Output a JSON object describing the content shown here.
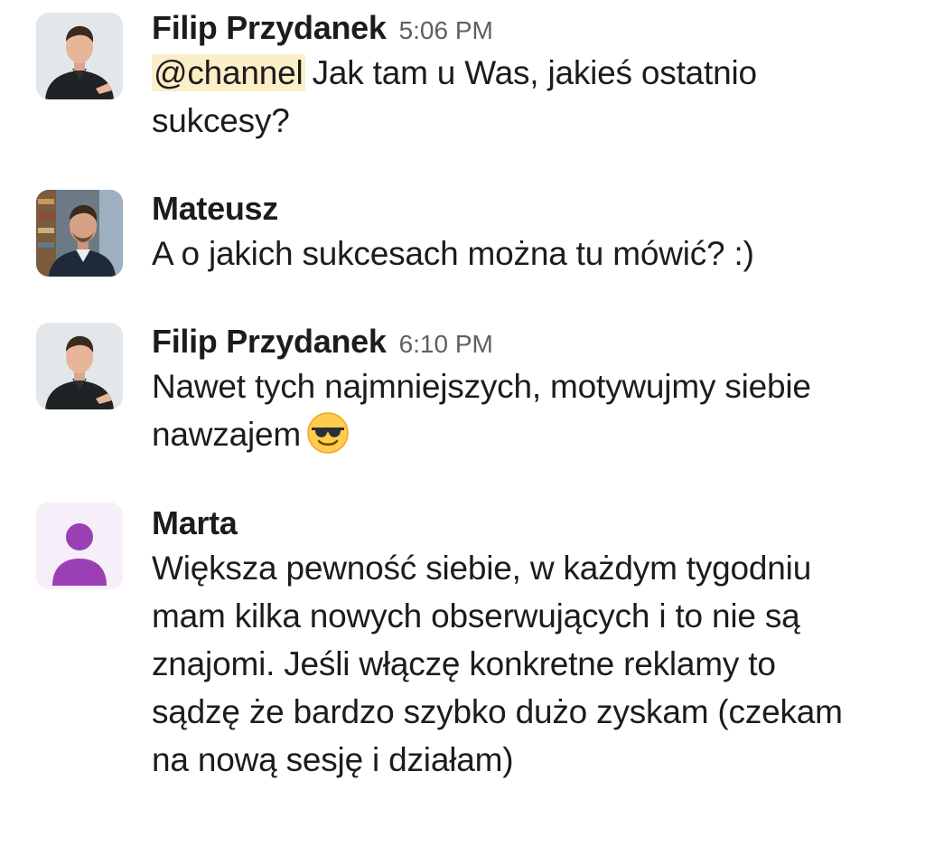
{
  "messages": [
    {
      "author": "Filip Przydanek",
      "time": "5:06 PM",
      "mention": "@channel",
      "text": "Jak tam u Was, jakieś ostatnio sukcesy?",
      "avatar_icon": "person-photo-icon"
    },
    {
      "author": "Mateusz",
      "time": "",
      "text": "A o jakich sukcesach można tu mówić? :)",
      "avatar_icon": "person-photo-icon"
    },
    {
      "author": "Filip Przydanek",
      "time": "6:10 PM",
      "text": "Nawet tych najmniejszych, motywujmy siebie nawzajem",
      "emoji": "smiling-face-with-sunglasses",
      "avatar_icon": "person-photo-icon"
    },
    {
      "author": "Marta",
      "time": "",
      "text": "Większa pewność siebie, w każdym tygodniu mam kilka nowych obserwujących i to nie są znajomi. Jeśli włączę konkretne reklamy to sądzę że bardzo szybko dużo zyskam (czekam na nową sesję i działam)",
      "avatar_icon": "default-user-icon"
    }
  ],
  "colors": {
    "mention_bg": "#fcefc7",
    "timestamp": "#616061",
    "default_avatar": "#9b3fb5",
    "default_avatar_bg": "#f4ecf7"
  }
}
